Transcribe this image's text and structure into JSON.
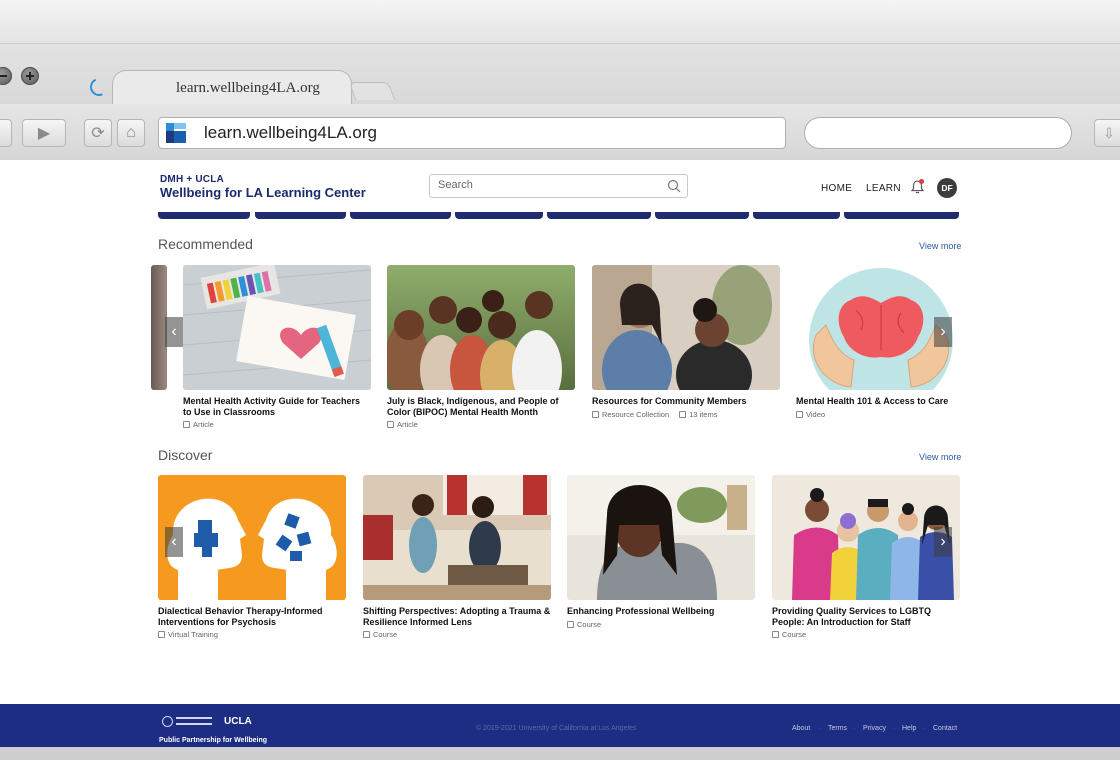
{
  "browser": {
    "tab_title": "learn.wellbeing4LA.org",
    "url": "learn.wellbeing4LA.org"
  },
  "header": {
    "brand_top": "DMH + UCLA",
    "brand_main": "Wellbeing for LA Learning Center",
    "search_placeholder": "Search",
    "nav": {
      "home": "HOME",
      "learn": "LEARN"
    },
    "avatar_initials": "DF"
  },
  "recommended": {
    "title": "Recommended",
    "view_more": "View more",
    "cards": [
      {
        "title": "Mental Health Activity Guide for Teachers to Use in Classrooms",
        "type": "Article"
      },
      {
        "title": "July is Black, Indigenous, and People of Color (BIPOC) Mental Health Month",
        "type": "Article"
      },
      {
        "title": "Resources for Community Members",
        "type": "Resource Collection",
        "items": "13 items"
      },
      {
        "title": "Mental Health 101 & Access to Care",
        "type": "Video"
      }
    ]
  },
  "discover": {
    "title": "Discover",
    "view_more": "View more",
    "cards": [
      {
        "title": "Dialectical Behavior Therapy-Informed Interventions for Psychosis",
        "type": "Virtual Training"
      },
      {
        "title": "Shifting Perspectives: Adopting a Trauma & Resilience Informed Lens",
        "type": "Course"
      },
      {
        "title": "Enhancing Professional Wellbeing",
        "type": "Course"
      },
      {
        "title": "Providing Quality Services to LGBTQ People: An Introduction for Staff",
        "type": "Course"
      }
    ]
  },
  "footer": {
    "ucla": "UCLA",
    "tagline": "Public Partnership for Wellbeing",
    "copyright": "© 2019-2021 University of California at Los Angeles",
    "links": [
      "About",
      "Terms",
      "Privacy",
      "Help",
      "Contact"
    ]
  }
}
